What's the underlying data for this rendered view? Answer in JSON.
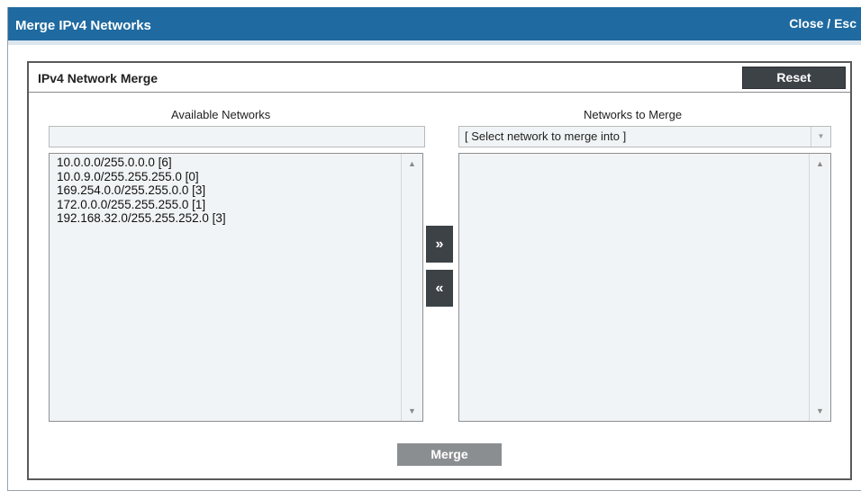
{
  "window": {
    "title": "Merge IPv4 Networks",
    "close_label": "Close / Esc"
  },
  "panel": {
    "title": "IPv4 Network Merge",
    "reset_label": "Reset"
  },
  "available": {
    "label": "Available Networks",
    "filter_value": "",
    "items": [
      "10.0.0.0/255.0.0.0 [6]",
      "10.0.9.0/255.255.255.0 [0]",
      "169.254.0.0/255.255.0.0 [3]",
      "172.0.0.0/255.255.255.0 [1]",
      "192.168.32.0/255.255.252.0 [3]"
    ]
  },
  "merge_target": {
    "label": "Networks to Merge",
    "selected": "[ Select network to merge into ]",
    "items": []
  },
  "actions": {
    "add_label": "»",
    "remove_label": "«",
    "merge_label": "Merge"
  },
  "icons": {
    "scroll_up": "triangle-up-icon",
    "scroll_down": "triangle-down-icon",
    "dropdown": "chevron-down-icon"
  }
}
